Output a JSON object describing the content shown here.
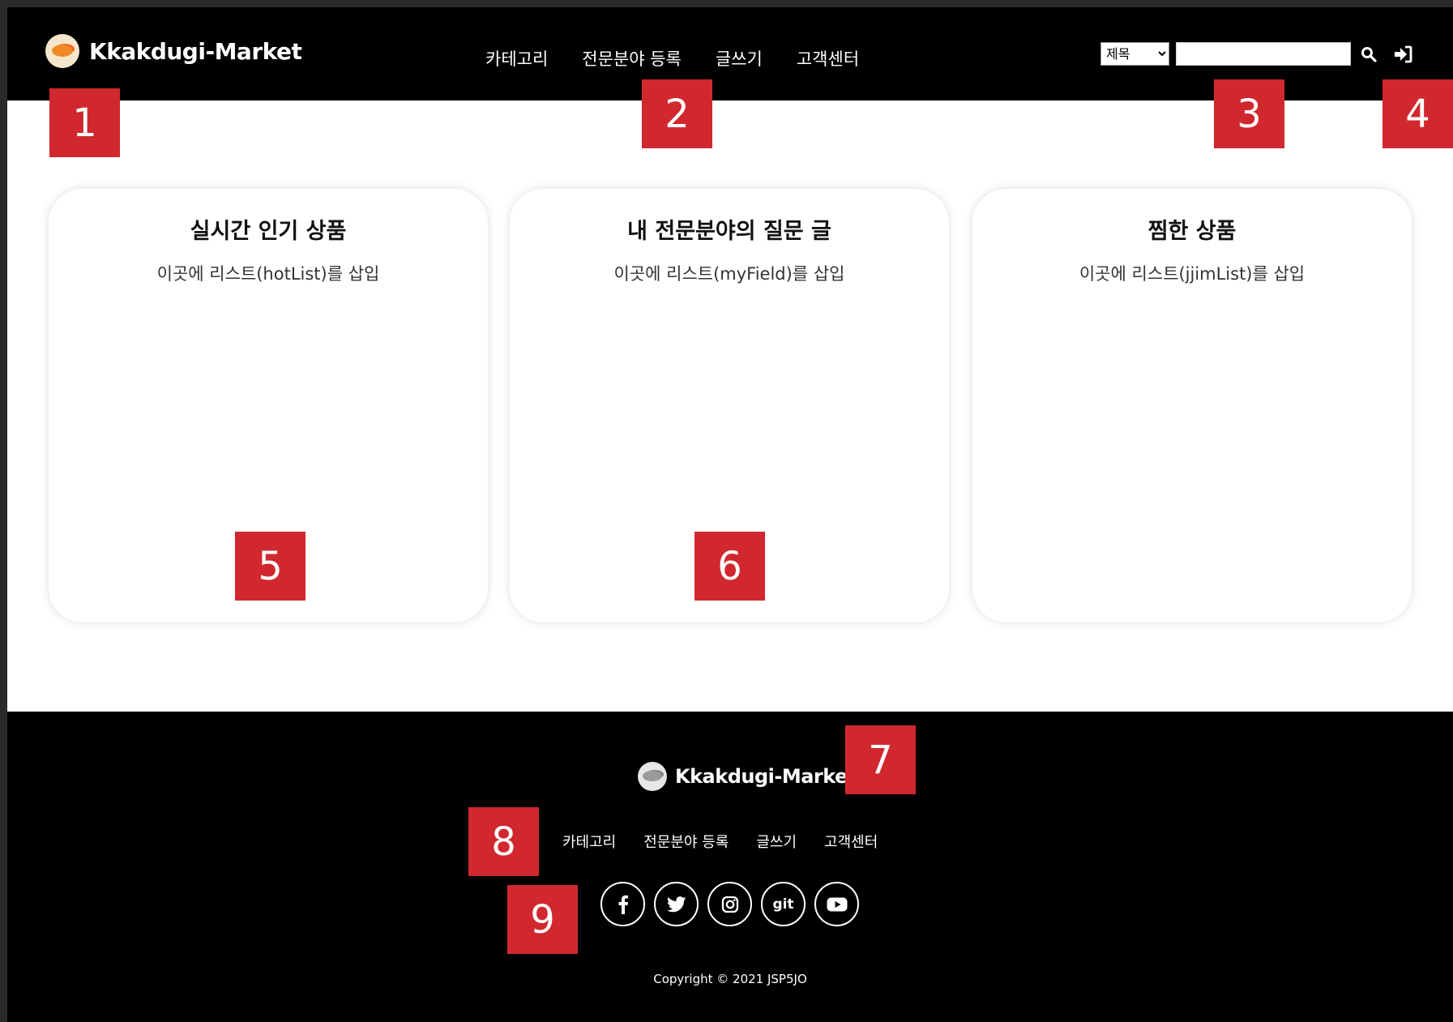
{
  "header": {
    "brand": "Kkakdugi-Market",
    "nav": [
      "카테고리",
      "전문분야 등록",
      "글쓰기",
      "고객센터"
    ],
    "search_select_value": "제목",
    "search_input_value": ""
  },
  "cards": [
    {
      "title": "실시간 인기 상품",
      "body": "이곳에 리스트(hotList)를 삽입"
    },
    {
      "title": "내 전문분야의 질문 글",
      "body": "이곳에 리스트(myField)를 삽입"
    },
    {
      "title": "찜한 상품",
      "body": "이곳에 리스트(jjimList)를 삽입"
    }
  ],
  "footer": {
    "brand": "Kkakdugi-Market",
    "nav": [
      "카테고리",
      "전문분야 등록",
      "글쓰기",
      "고객센터"
    ],
    "social": [
      {
        "icon": "facebook-icon"
      },
      {
        "icon": "twitter-icon"
      },
      {
        "icon": "instagram-icon"
      },
      {
        "icon": "git-icon",
        "label": "git"
      },
      {
        "icon": "youtube-icon"
      }
    ],
    "copyright": "Copyright © 2021 JSP5JO"
  },
  "markers": [
    "1",
    "2",
    "3",
    "4",
    "5",
    "6",
    "7",
    "8",
    "9"
  ],
  "colors": {
    "marker": "#d0282e",
    "header_bg": "#000000",
    "footer_bg": "#000000"
  }
}
